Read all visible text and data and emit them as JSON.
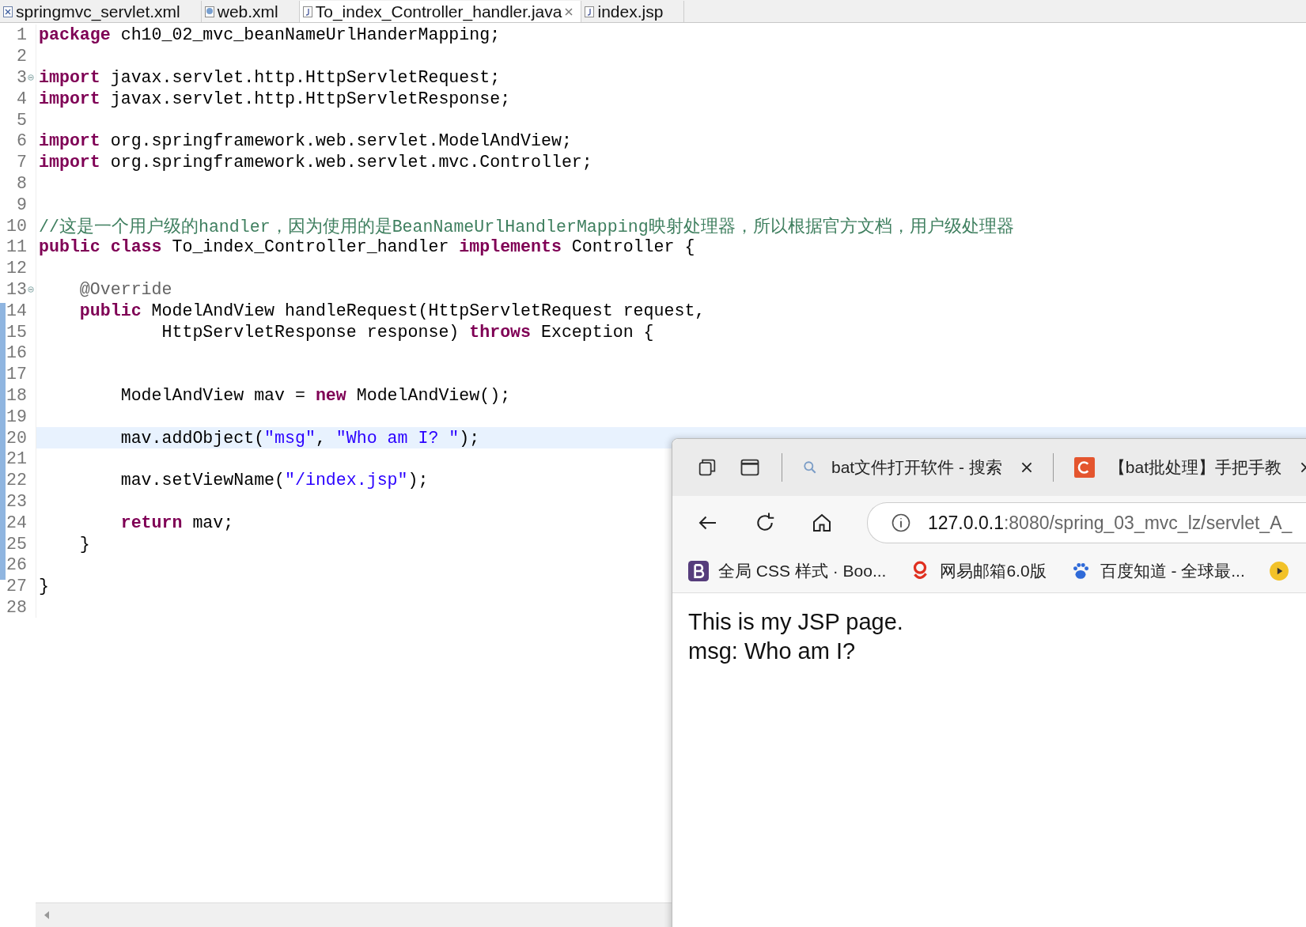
{
  "editor_tabs": [
    {
      "label": "springmvc_servlet.xml",
      "kind": "xml",
      "selected": false
    },
    {
      "label": "web.xml",
      "kind": "webxml",
      "selected": false
    },
    {
      "label": "To_index_Controller_handler.java",
      "kind": "java",
      "selected": true
    },
    {
      "label": "index.jsp",
      "kind": "jsp",
      "selected": false
    }
  ],
  "code_lines": [
    {
      "number": "1",
      "fold": false,
      "current": false,
      "tokens": [
        {
          "kind": "keyword",
          "text": "package"
        },
        {
          "kind": "plain",
          "text": " ch10_02_mvc_beanNameUrlHanderMapping;"
        }
      ]
    },
    {
      "number": "2",
      "fold": false,
      "current": false
    },
    {
      "number": "3",
      "fold": true,
      "current": false,
      "tokens": [
        {
          "kind": "keyword",
          "text": "import"
        },
        {
          "kind": "plain",
          "text": " javax.servlet.http.HttpServletRequest;"
        }
      ]
    },
    {
      "number": "4",
      "fold": false,
      "current": false,
      "tokens": [
        {
          "kind": "keyword",
          "text": "import"
        },
        {
          "kind": "plain",
          "text": " javax.servlet.http.HttpServletResponse;"
        }
      ]
    },
    {
      "number": "5",
      "fold": false,
      "current": false
    },
    {
      "number": "6",
      "fold": false,
      "current": false,
      "tokens": [
        {
          "kind": "keyword",
          "text": "import"
        },
        {
          "kind": "plain",
          "text": " org.springframework.web.servlet.ModelAndView;"
        }
      ]
    },
    {
      "number": "7",
      "fold": false,
      "current": false,
      "tokens": [
        {
          "kind": "keyword",
          "text": "import"
        },
        {
          "kind": "plain",
          "text": " org.springframework.web.servlet.mvc.Controller;"
        }
      ]
    },
    {
      "number": "8",
      "fold": false,
      "current": false
    },
    {
      "number": "9",
      "fold": false,
      "current": false
    },
    {
      "number": "10",
      "fold": false,
      "current": false,
      "tokens": [
        {
          "kind": "comment",
          "text": "//这是一个用户级的handler，因为使用的是BeanNameUrlHandlerMapping映射处理器，所以根据官方文档，用户级处理器"
        }
      ]
    },
    {
      "number": "11",
      "fold": false,
      "current": false,
      "tokens": [
        {
          "kind": "keyword",
          "text": "public class"
        },
        {
          "kind": "plain",
          "text": " To_index_Controller_handler "
        },
        {
          "kind": "keyword",
          "text": "implements"
        },
        {
          "kind": "plain",
          "text": " Controller {"
        }
      ]
    },
    {
      "number": "12",
      "fold": false,
      "current": false
    },
    {
      "number": "13",
      "fold": true,
      "current": false,
      "tokens": [
        {
          "kind": "annotation",
          "text": "    @Override"
        }
      ]
    },
    {
      "number": "14",
      "fold": false,
      "current": false,
      "tokens": [
        {
          "kind": "keyword",
          "text": "    public"
        },
        {
          "kind": "plain",
          "text": " ModelAndView handleRequest(HttpServletRequest request,"
        }
      ]
    },
    {
      "number": "15",
      "fold": false,
      "current": false,
      "tokens": [
        {
          "kind": "plain",
          "text": "            HttpServletResponse response) "
        },
        {
          "kind": "keyword",
          "text": "throws"
        },
        {
          "kind": "plain",
          "text": " Exception {"
        }
      ]
    },
    {
      "number": "16",
      "fold": false,
      "current": false
    },
    {
      "number": "17",
      "fold": false,
      "current": false
    },
    {
      "number": "18",
      "fold": false,
      "current": false,
      "tokens": [
        {
          "kind": "plain",
          "text": "        ModelAndView mav = "
        },
        {
          "kind": "keyword",
          "text": "new"
        },
        {
          "kind": "plain",
          "text": " ModelAndView();"
        }
      ]
    },
    {
      "number": "19",
      "fold": false,
      "current": false
    },
    {
      "number": "20",
      "fold": false,
      "current": true,
      "tokens": [
        {
          "kind": "plain",
          "text": "        mav.addObject("
        },
        {
          "kind": "string",
          "text": "\"msg\""
        },
        {
          "kind": "plain",
          "text": ", "
        },
        {
          "kind": "string",
          "text": "\"Who am I? \""
        },
        {
          "kind": "plain",
          "text": ");"
        }
      ]
    },
    {
      "number": "21",
      "fold": false,
      "current": false
    },
    {
      "number": "22",
      "fold": false,
      "current": false,
      "tokens": [
        {
          "kind": "plain",
          "text": "        mav.setViewName("
        },
        {
          "kind": "string",
          "text": "\"/index.jsp\""
        },
        {
          "kind": "plain",
          "text": ");"
        }
      ]
    },
    {
      "number": "23",
      "fold": false,
      "current": false
    },
    {
      "number": "24",
      "fold": false,
      "current": false,
      "tokens": [
        {
          "kind": "keyword",
          "text": "        return"
        },
        {
          "kind": "plain",
          "text": " mav;"
        }
      ]
    },
    {
      "number": "25",
      "fold": false,
      "current": false,
      "tokens": [
        {
          "kind": "plain",
          "text": "    }"
        }
      ]
    },
    {
      "number": "26",
      "fold": false,
      "current": false
    },
    {
      "number": "27",
      "fold": false,
      "current": false,
      "tokens": [
        {
          "kind": "plain",
          "text": "}"
        }
      ]
    },
    {
      "number": "28",
      "fold": false,
      "current": false
    }
  ],
  "browser": {
    "tabs": [
      {
        "title": "bat文件打开软件 - 搜索",
        "kind": "search"
      },
      {
        "title": "【bat批处理】手把手教",
        "kind": "site"
      }
    ],
    "address": {
      "host": "127.0.0.1",
      "path": ":8080/spring_03_mvc_lz/servlet_A_"
    },
    "bookmarks": [
      {
        "label": "全局 CSS 样式 · Boo...",
        "kind": "bootstrap"
      },
      {
        "label": "网易邮箱6.0版",
        "kind": "mail"
      },
      {
        "label": "百度知道 - 全球最...",
        "kind": "baidu"
      },
      {
        "kind": "video"
      }
    ],
    "page_lines": [
      "This is my JSP page.",
      "msg: Who am I?"
    ]
  }
}
